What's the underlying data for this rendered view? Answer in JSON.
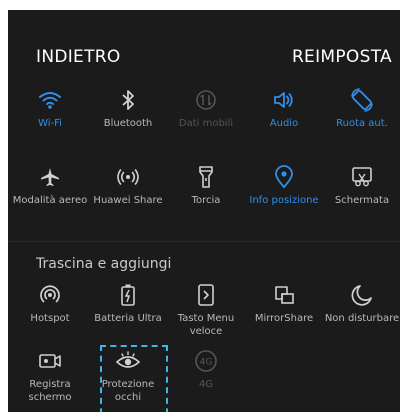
{
  "header": {
    "back_label": "INDIETRO",
    "reset_label": "REIMPOSTA"
  },
  "active_tiles": [
    {
      "label": "Wi-Fi",
      "icon": "wifi-icon",
      "state": "on"
    },
    {
      "label": "Bluetooth",
      "icon": "bluetooth-icon",
      "state": "off"
    },
    {
      "label": "Dati mobili",
      "icon": "mobile-data-icon",
      "state": "disabled"
    },
    {
      "label": "Audio",
      "icon": "speaker-icon",
      "state": "on"
    },
    {
      "label": "Ruota aut.",
      "icon": "auto-rotate-icon",
      "state": "on"
    },
    {
      "label": "Modalità aereo",
      "icon": "airplane-icon",
      "state": "off"
    },
    {
      "label": "Huawei Share",
      "icon": "huawei-share-icon",
      "state": "off"
    },
    {
      "label": "Torcia",
      "icon": "flashlight-icon",
      "state": "off"
    },
    {
      "label": "Info posizione",
      "icon": "location-icon",
      "state": "on"
    },
    {
      "label": "Schermata",
      "icon": "screenshot-icon",
      "state": "off"
    }
  ],
  "section_title": "Trascina e aggiungi",
  "available_tiles": [
    {
      "label": "Hotspot",
      "icon": "hotspot-icon",
      "state": "off"
    },
    {
      "label": "Batteria Ultra",
      "icon": "battery-icon",
      "state": "off"
    },
    {
      "label": "Tasto Menu veloce",
      "icon": "floating-menu-icon",
      "state": "off"
    },
    {
      "label": "MirrorShare",
      "icon": "mirror-share-icon",
      "state": "off"
    },
    {
      "label": "Non disturbare",
      "icon": "moon-icon",
      "state": "off"
    },
    {
      "label": "Registra schermo",
      "icon": "screen-record-icon",
      "state": "off"
    },
    {
      "label": "Protezione occhi",
      "icon": "eye-icon",
      "state": "off"
    },
    {
      "label": "4G",
      "icon": "4g-icon",
      "state": "disabled"
    }
  ],
  "colors": {
    "accent": "#2f8fe9",
    "panel": "#1b1b1b",
    "highlight": "#3fb6e6"
  }
}
